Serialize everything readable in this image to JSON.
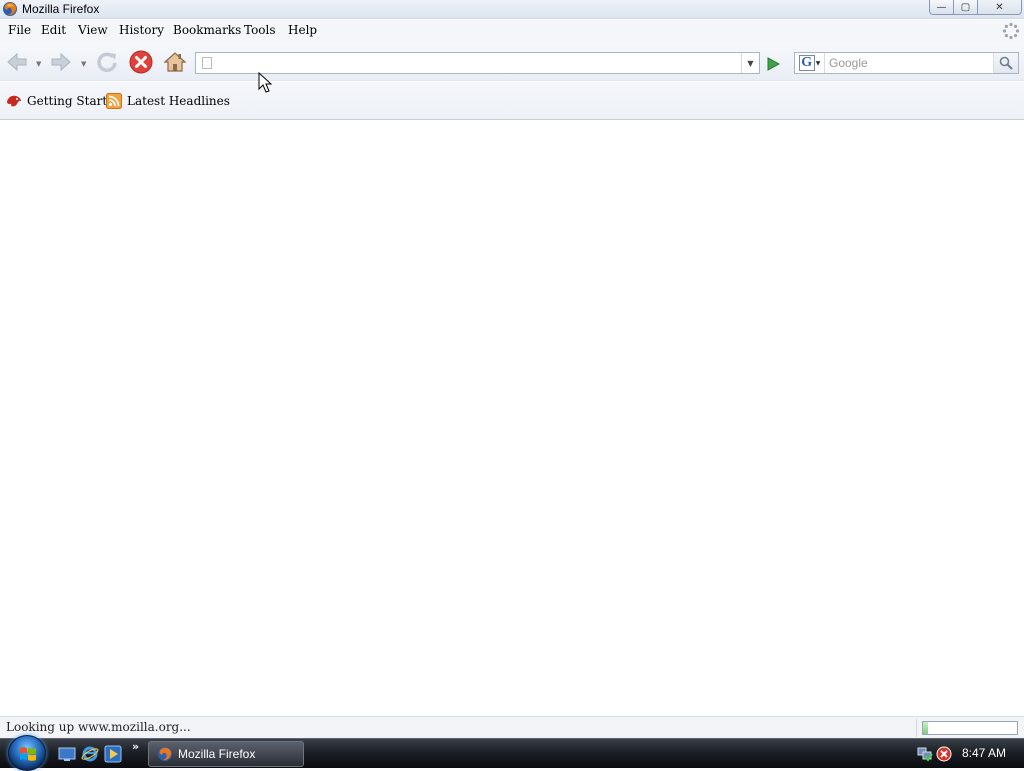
{
  "window": {
    "title": "Mozilla Firefox",
    "controls": {
      "minimize": "—",
      "maximize": "▢",
      "close": "✕"
    }
  },
  "menubar": {
    "items": [
      {
        "label": "File"
      },
      {
        "label": "Edit"
      },
      {
        "label": "View"
      },
      {
        "label": "History"
      },
      {
        "label": "Bookmarks"
      },
      {
        "label": "Tools"
      },
      {
        "label": "Help"
      }
    ]
  },
  "toolbar": {
    "buttons": [
      "back-icon",
      "forward-icon",
      "reload-icon",
      "stop-icon",
      "home-icon"
    ],
    "url": {
      "value": "",
      "dropdown_glyph": "▼"
    },
    "search": {
      "placeholder": "Google",
      "engine": "G"
    }
  },
  "bookmarks": {
    "items": [
      {
        "label": "Getting Started",
        "icon": "firefox-bookmark-icon"
      },
      {
        "label": "Latest Headlines",
        "icon": "rss-feed-icon"
      }
    ]
  },
  "statusbar": {
    "message": "Looking up www.mozilla.org...",
    "progress": 0.05
  },
  "taskbar": {
    "more_glyph": "»",
    "task": {
      "label": "Mozilla Firefox"
    },
    "clock": "8:47 AM"
  },
  "colors": {
    "stop_red": "#e0413a",
    "go_green": "#3ea34a",
    "taskbar": "#1c1f25"
  }
}
